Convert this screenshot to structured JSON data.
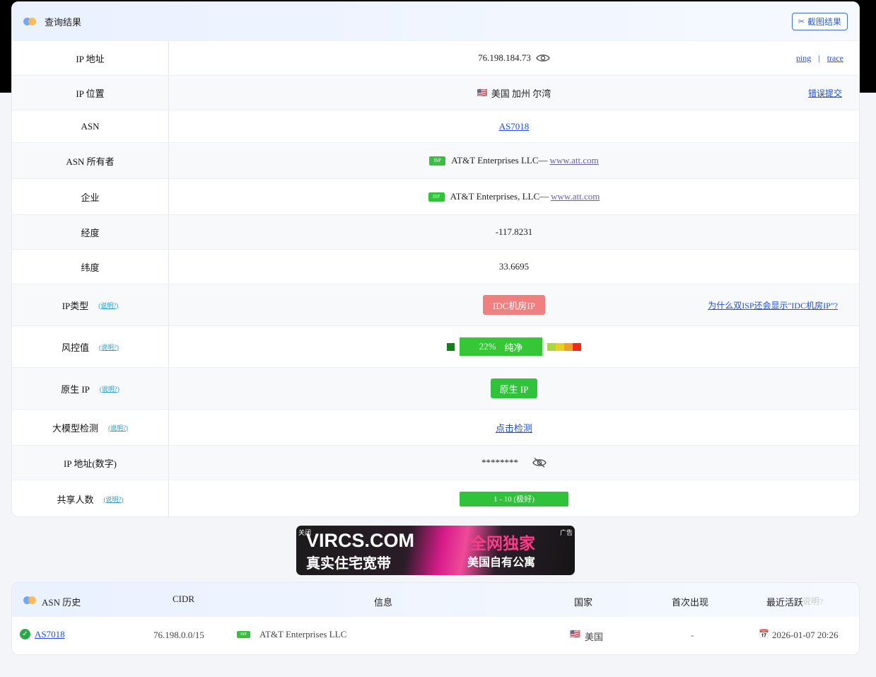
{
  "result": {
    "title": "查询结果",
    "screenshot_button": "截图结果",
    "ip_address": {
      "label": "IP 地址",
      "value": "76.198.184.73",
      "ping": "ping",
      "separator": "|",
      "trace": "trace"
    },
    "ip_location": {
      "label": "IP 位置",
      "flag": "🇺🇸",
      "value": "美国 加州 尔湾",
      "report": "错误提交"
    },
    "asn": {
      "label": "ASN",
      "value": "AS7018"
    },
    "asn_owner": {
      "label": "ASN 所有者",
      "badge": "ISP",
      "name": "AT&T Enterprises LLC",
      "dash": "—",
      "site": "www.att.com"
    },
    "company": {
      "label": "企业",
      "badge": "ISP",
      "name": "AT&T Enterprises, LLC",
      "dash": "—",
      "site": "www.att.com"
    },
    "longitude": {
      "label": "经度",
      "value": "-117.8231"
    },
    "latitude": {
      "label": "纬度",
      "value": "33.6695"
    },
    "ip_type": {
      "label": "IP类型",
      "hint": "(说明?)",
      "value": "IDC机房IP",
      "question": "为什么双ISP还会显示\"IDC机房IP\"?"
    },
    "risk": {
      "label": "风控值",
      "hint": "(说明?)",
      "percent": "22%",
      "text": "纯净",
      "score": 0.22,
      "colors": [
        "#14801c",
        "#35c735",
        "#a8d840",
        "#e8d020",
        "#f0a020",
        "#f04020"
      ]
    },
    "native_ip": {
      "label": "原生 IP",
      "hint": "(说明?)",
      "value": "原生 IP"
    },
    "llm_check": {
      "label": "大模型检测",
      "hint": "(说明?)",
      "value": "点击检测"
    },
    "ip_numeric": {
      "label": "IP 地址(数字)",
      "value": "********"
    },
    "shared_users": {
      "label": "共享人数",
      "hint": "(说明?)",
      "value": "1 - 10 (极好)"
    }
  },
  "ad": {
    "close": "关闭",
    "label": "广告",
    "line1": "VIRCS.COM",
    "line2": "真实住宅宽带",
    "right1": "全网独家",
    "right2": "美国自有公寓"
  },
  "asn_history": {
    "title": "ASN 历史",
    "columns": {
      "cidr": "CIDR",
      "info": "信息",
      "country": "国家",
      "first_seen": "首次出现",
      "last_active": "最近活跃",
      "last_active_hint": "说明?"
    },
    "rows": [
      {
        "asn": "AS7018",
        "cidr": "76.198.0.0/15",
        "badge": "ISP",
        "info": "AT&T Enterprises LLC",
        "flag": "🇺🇸",
        "country": "美国",
        "first_seen": "-",
        "last_active": "2026-01-07 20:26"
      }
    ]
  }
}
